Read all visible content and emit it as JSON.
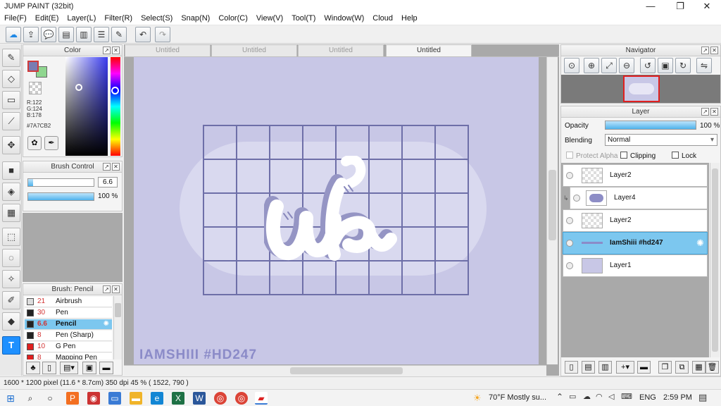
{
  "window": {
    "title": "JUMP PAINT (32bit)",
    "min": "—",
    "restore": "❐",
    "close": "✕"
  },
  "menu": [
    "File(F)",
    "Edit(E)",
    "Layer(L)",
    "Filter(R)",
    "Select(S)",
    "Snap(N)",
    "Color(C)",
    "View(V)",
    "Tool(T)",
    "Window(W)",
    "Cloud",
    "Help"
  ],
  "color_panel": {
    "title": "Color",
    "r": "R:122",
    "g": "G:124",
    "b": "B:178",
    "hex": "#7A7CB2",
    "fg_color": "#7A7CB2",
    "bg_color": "#8fd68f"
  },
  "brush_control": {
    "title": "Brush Control",
    "size": "6.6",
    "opacity": "100 %",
    "opacity_fraction": 1.0,
    "size_fraction": 0.07
  },
  "brush_panel": {
    "title": "Brush: Pencil",
    "items": [
      {
        "size": "21",
        "name": "Airbrush",
        "swatch": "#dddddd"
      },
      {
        "size": "30",
        "name": "Pen",
        "swatch": "#222222"
      },
      {
        "size": "6.6",
        "name": "Pencil",
        "swatch": "#222222"
      },
      {
        "size": "8",
        "name": "Pen (Sharp)",
        "swatch": "#222222"
      },
      {
        "size": "10",
        "name": "G Pen",
        "swatch": "#e02020"
      },
      {
        "size": "8",
        "name": "Mapping Pen",
        "swatch": "#e02020"
      }
    ]
  },
  "doc_tabs": [
    "Untitled",
    "Untitled",
    "Untitled",
    "Untitled"
  ],
  "canvas": {
    "watermark": "IAMSHIII #HD247",
    "logo_text": "ufr",
    "bg": "#c8c7e6",
    "grid_color": "#6e6fa8"
  },
  "navigator": {
    "title": "Navigator"
  },
  "layer_panel": {
    "title": "Layer",
    "opacity_label": "Opacity",
    "opacity_value": "100 %",
    "blending_label": "Blending",
    "blending_value": "Normal",
    "protect_alpha": "Protect Alpha",
    "clipping": "Clipping",
    "lock": "Lock",
    "layers": [
      {
        "name": "Layer2"
      },
      {
        "name": "Layer4"
      },
      {
        "name": "Layer2"
      },
      {
        "name": "IamShiii #hd247"
      },
      {
        "name": "Layer1"
      }
    ]
  },
  "status": {
    "text": "1600 * 1200 pixel   (11.6 * 8.7cm)   350 dpi   45 %   ( 1522, 790 )"
  },
  "taskbar": {
    "weather": "70°F  Mostly su...",
    "lang": "ENG",
    "time": "2:59 PM"
  }
}
